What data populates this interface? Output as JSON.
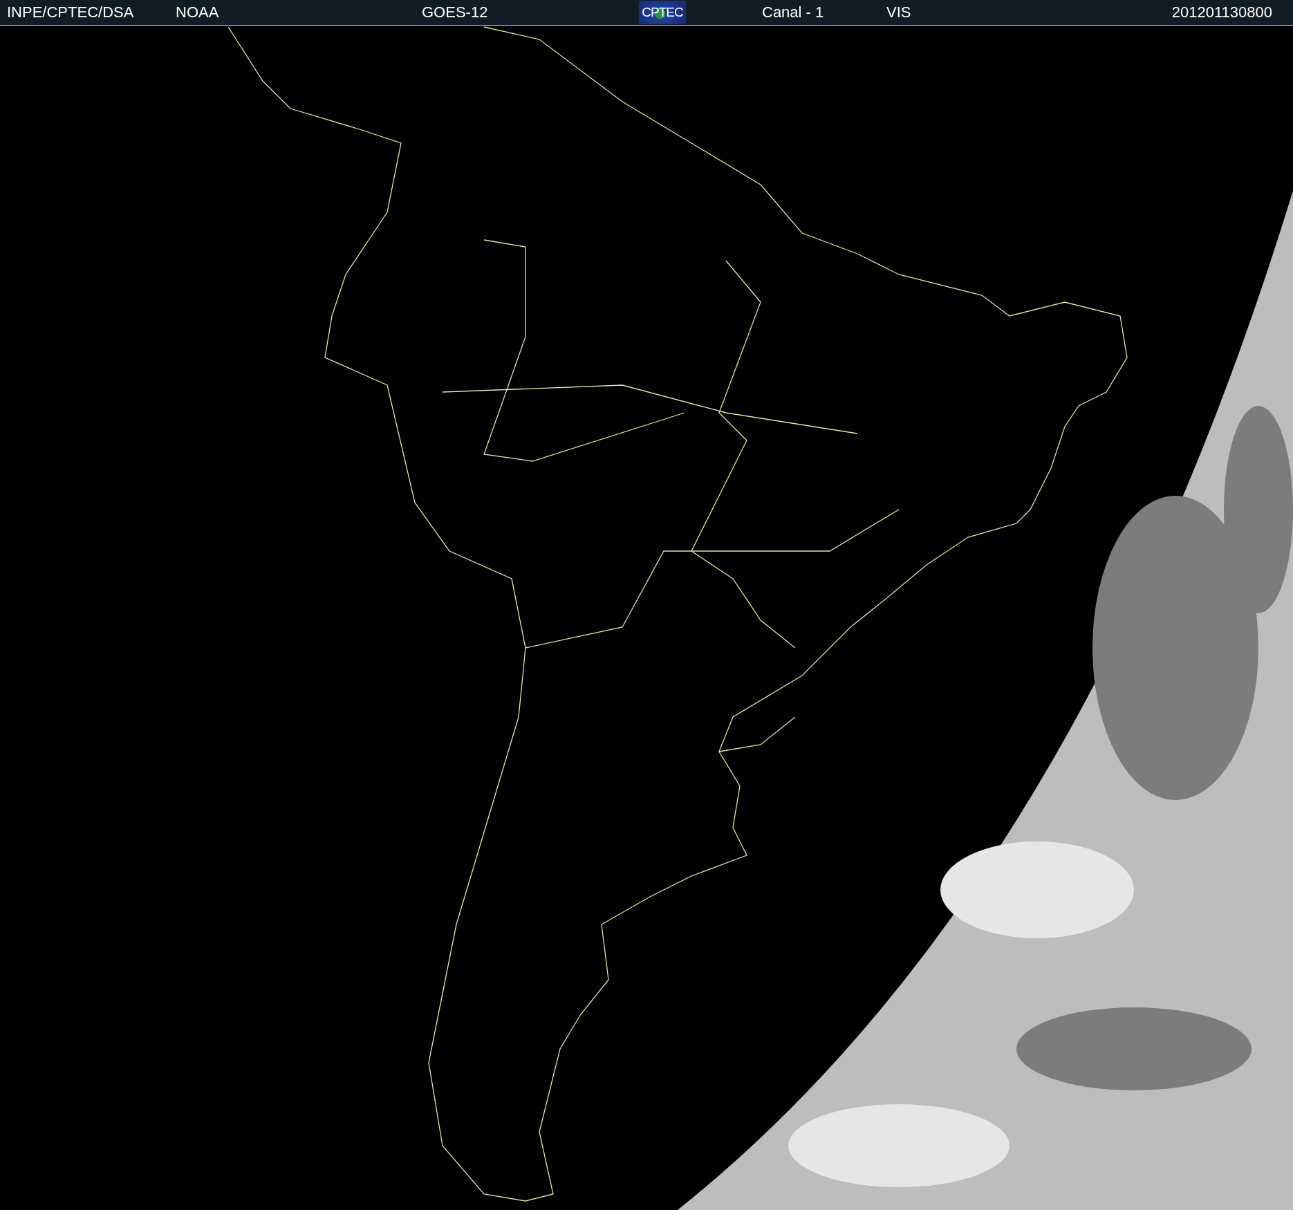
{
  "header": {
    "items": [
      {
        "kind": "text",
        "text": "INPE/CPTEC/DSA"
      },
      {
        "kind": "text",
        "text": "NOAA"
      },
      {
        "kind": "text",
        "text": "GOES-12"
      },
      {
        "kind": "logo",
        "text": "CPTEC"
      },
      {
        "kind": "text",
        "text": "Canal - 1"
      },
      {
        "kind": "text",
        "text": "VIS"
      },
      {
        "kind": "text",
        "text": "201201130800"
      }
    ]
  }
}
